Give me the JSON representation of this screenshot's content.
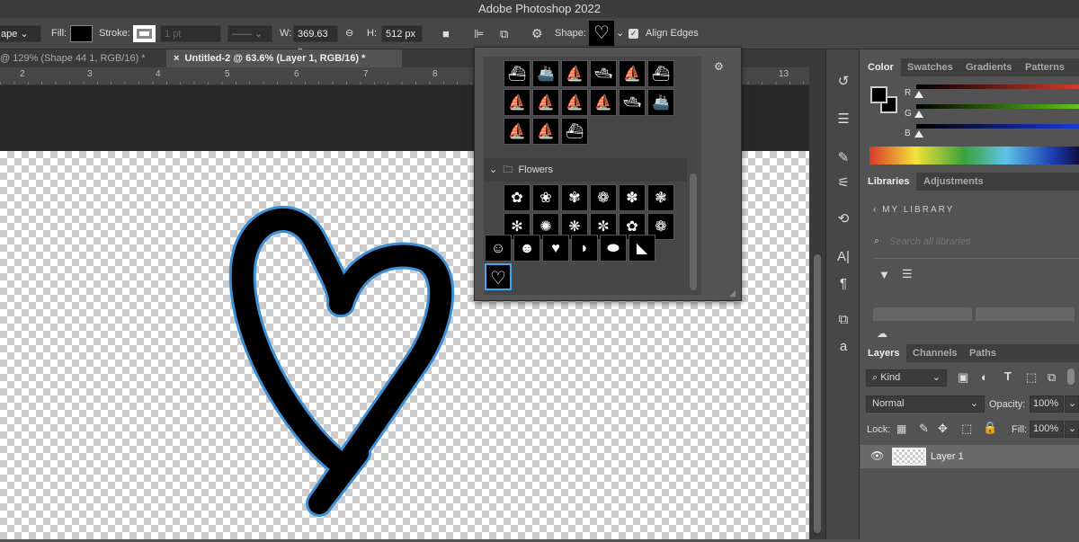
{
  "app": {
    "title": "Adobe Photoshop 2022"
  },
  "options": {
    "mode": "ape",
    "fill_label": "Fill:",
    "stroke_label": "Stroke:",
    "stroke_width": "1 pt",
    "w_label": "W:",
    "w_value": "369.63 p",
    "h_label": "H:",
    "h_value": "512 px",
    "shape_label": "Shape:",
    "align_edges": "Align Edges"
  },
  "tabs": [
    {
      "label": "@ 129% (Shape 44 1, RGB/16) *"
    },
    {
      "label": "Untitled-2 @ 63.6% (Layer 1, RGB/16) *"
    }
  ],
  "ruler": [
    "2",
    "3",
    "4",
    "5",
    "6",
    "7",
    "8",
    "13"
  ],
  "shapes": {
    "group": "Flowers",
    "boats": [
      "⛴",
      "🚢",
      "⛵",
      "🛥",
      "⛵",
      "⛴",
      "⛵",
      "⛵",
      "⛵",
      "⛵",
      "🛥",
      "🚢",
      "⛵",
      "⛵",
      "⛴"
    ],
    "flowers": [
      "✿",
      "❀",
      "✾",
      "❁",
      "✽",
      "❃",
      "✻",
      "✺",
      "❋",
      "✼",
      "✿",
      "❁"
    ],
    "misc": [
      "☺",
      "☻",
      "♥",
      "◗",
      "⬬",
      "◣"
    ],
    "selected": "♡"
  },
  "color_panel": {
    "tabs": [
      "Color",
      "Swatches",
      "Gradients",
      "Patterns"
    ],
    "channels": [
      "R",
      "G",
      "B"
    ]
  },
  "libraries": {
    "tabs": [
      "Libraries",
      "Adjustments"
    ],
    "back": "MY LIBRARY",
    "search_placeholder": "Search all libraries"
  },
  "layers": {
    "tabs": [
      "Layers",
      "Channels",
      "Paths"
    ],
    "kind": "Kind",
    "blend": "Normal",
    "opacity_label": "Opacity:",
    "opacity": "100%",
    "lock_label": "Lock:",
    "fill_label": "Fill:",
    "fill": "100%",
    "items": [
      {
        "name": "Layer 1"
      }
    ]
  }
}
